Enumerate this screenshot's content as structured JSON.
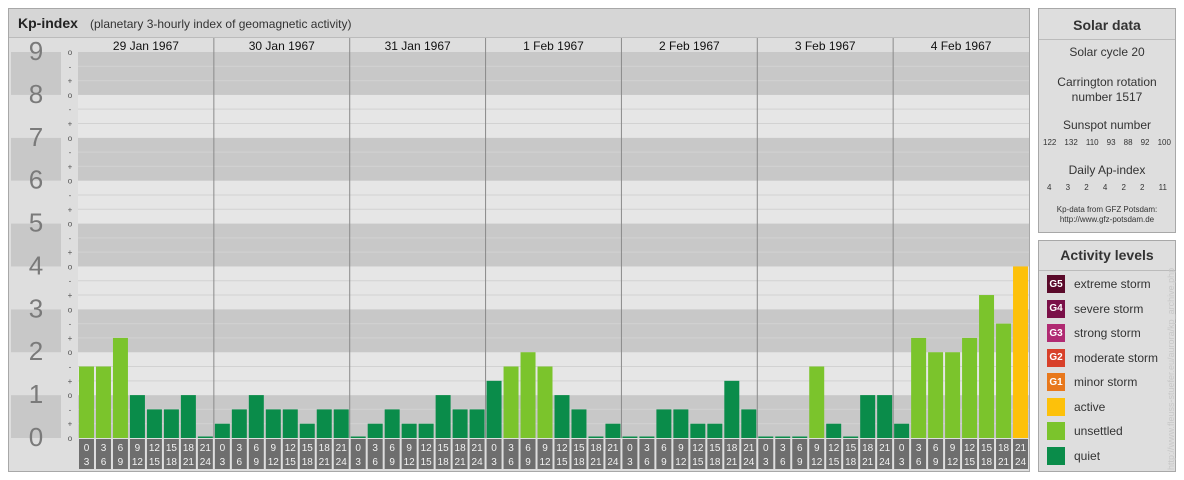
{
  "header": {
    "title": "Kp-index",
    "subtitle": "(planetary 3-hourly index of geomagnetic activity)"
  },
  "colors": {
    "quiet": "#0a8c4a",
    "unsettled": "#7bc42c",
    "active": "#fdc10a",
    "panel_bg": "#dedede",
    "band_dark": "#c8c8c8",
    "band_light": "#e6e6e6",
    "label_bg": "#6e6e6e"
  },
  "chart_data": {
    "type": "bar",
    "title": "Kp-index",
    "ylim": [
      0,
      9
    ],
    "y_major_ticks": [
      "0",
      "1",
      "2",
      "3",
      "4",
      "5",
      "6",
      "7",
      "8",
      "9"
    ],
    "y_minor_ticks": [
      "-",
      "o",
      "+"
    ],
    "days": [
      "29 Jan 1967",
      "30 Jan 1967",
      "31 Jan 1967",
      "1 Feb 1967",
      "2 Feb 1967",
      "3 Feb 1967",
      "4 Feb 1967"
    ],
    "interval_start_labels": [
      "0",
      "3",
      "6",
      "9",
      "12",
      "15",
      "18",
      "21"
    ],
    "interval_end_labels": [
      "3",
      "6",
      "9",
      "12",
      "15",
      "18",
      "21",
      "24"
    ],
    "series": [
      {
        "values": [
          1.667,
          1.667,
          2.333,
          1.0,
          0.667,
          0.667,
          1.0,
          0.0,
          0.333,
          0.667,
          1.0,
          0.667,
          0.667,
          0.333,
          0.667,
          0.667,
          0.0,
          0.333,
          0.667,
          0.333,
          0.333,
          1.0,
          0.667,
          0.667,
          1.333,
          1.667,
          2.0,
          1.667,
          1.0,
          0.667,
          0.0,
          0.333,
          0.0,
          0.0,
          0.667,
          0.667,
          0.333,
          0.333,
          1.333,
          0.667,
          0.0,
          0.0,
          0.0,
          1.667,
          0.333,
          0.0,
          1.0,
          1.0,
          0.333,
          2.333,
          2.0,
          2.0,
          2.333,
          3.333,
          2.667,
          4.0
        ],
        "levels": [
          "unsettled",
          "unsettled",
          "unsettled",
          "quiet",
          "quiet",
          "quiet",
          "quiet",
          "quiet",
          "quiet",
          "quiet",
          "quiet",
          "quiet",
          "quiet",
          "quiet",
          "quiet",
          "quiet",
          "quiet",
          "quiet",
          "quiet",
          "quiet",
          "quiet",
          "quiet",
          "quiet",
          "quiet",
          "quiet",
          "unsettled",
          "unsettled",
          "unsettled",
          "quiet",
          "quiet",
          "quiet",
          "quiet",
          "quiet",
          "quiet",
          "quiet",
          "quiet",
          "quiet",
          "quiet",
          "quiet",
          "quiet",
          "quiet",
          "quiet",
          "quiet",
          "unsettled",
          "quiet",
          "quiet",
          "quiet",
          "quiet",
          "quiet",
          "unsettled",
          "unsettled",
          "unsettled",
          "unsettled",
          "unsettled",
          "unsettled",
          "active"
        ]
      }
    ]
  },
  "solar": {
    "title": "Solar data",
    "cycle": "Solar cycle 20",
    "carrington_line1": "Carrington rotation",
    "carrington_line2": "number 1517",
    "sunspot_title": "Sunspot number",
    "sunspot_values": [
      "122",
      "132",
      "110",
      "93",
      "88",
      "92",
      "100"
    ],
    "ap_title": "Daily Ap-index",
    "ap_values": [
      "4",
      "3",
      "2",
      "4",
      "2",
      "2",
      "11"
    ],
    "credit_line1": "Kp-data from GFZ Potsdam:",
    "credit_line2": "http://www.gfz-potsdam.de"
  },
  "legend": {
    "title": "Activity levels",
    "items": [
      {
        "badge": "G5",
        "label": "extreme storm",
        "color": "#5a0a2a"
      },
      {
        "badge": "G4",
        "label": "severe storm",
        "color": "#7a1048"
      },
      {
        "badge": "G3",
        "label": "strong storm",
        "color": "#b02a72"
      },
      {
        "badge": "G2",
        "label": "moderate storm",
        "color": "#d8402a"
      },
      {
        "badge": "G1",
        "label": "minor storm",
        "color": "#e8781c"
      },
      {
        "badge": "",
        "label": "active",
        "color": "#fdc10a"
      },
      {
        "badge": "",
        "label": "unsettled",
        "color": "#7bc42c"
      },
      {
        "badge": "",
        "label": "quiet",
        "color": "#0a8c4a"
      }
    ]
  },
  "watermark": "http://www.fleuss-stuefer.eu/aurora/kp_archive.php"
}
